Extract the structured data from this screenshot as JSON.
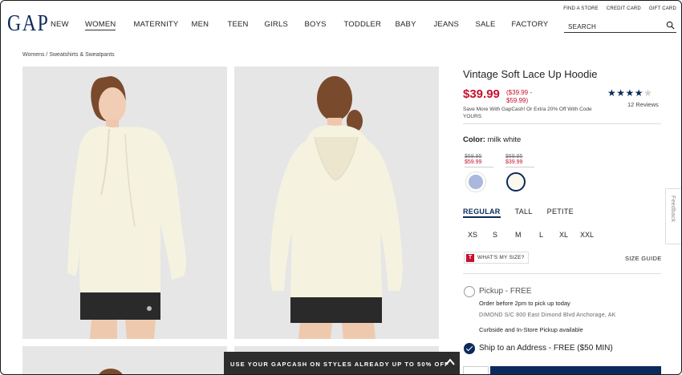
{
  "header": {
    "logo": "GAP",
    "nav": [
      "NEW",
      "WOMEN",
      "MATERNITY",
      "MEN",
      "TEEN",
      "GIRLS",
      "BOYS",
      "TODDLER",
      "BABY",
      "JEANS",
      "SALE",
      "FACTORY"
    ],
    "active_nav": "WOMEN",
    "utility_links": [
      "FIND A STORE",
      "CREDIT CARD",
      "GIFT CARD"
    ],
    "search_placeholder": "SEARCH"
  },
  "breadcrumb": "Womens / Sweatshirts & Sweatpants",
  "product": {
    "title": "Vintage Soft Lace Up Hoodie",
    "price": "$39.99",
    "price_range_line1": "($39.99 -",
    "price_range_line2": "$59.99)",
    "rating": 4,
    "rating_max": 5,
    "reviews": "12 Reviews",
    "promo": "Save More With GapCash! Or Extra 20% Off With Code YOURS",
    "color_label": "Color:",
    "color_value": "milk white",
    "swatches": [
      {
        "old_price": "$69.95",
        "new_price": "$59.99",
        "color": "#a9b8dc",
        "selected": false
      },
      {
        "old_price": "$69.95",
        "new_price": "$39.99",
        "color": "#fbf9ee",
        "selected": true
      }
    ],
    "fit_tabs": [
      "REGULAR",
      "TALL",
      "PETITE"
    ],
    "active_fit": "REGULAR",
    "sizes": [
      "XS",
      "S",
      "M",
      "L",
      "XL",
      "XXL"
    ],
    "whats_my_size": "WHAT'S MY SIZE?",
    "whats_my_size_badge": "T",
    "size_guide": "SIZE GUIDE"
  },
  "fulfillment": {
    "pickup": {
      "label": "Pickup - FREE",
      "sub": "Order before 2pm to pick up today",
      "store": "DIMOND S/C 800 East Dimond Blvd Anchorage, AK",
      "note": "Curbside and In-Store Pickup available",
      "selected": false
    },
    "ship": {
      "label": "Ship to an Address - FREE ($50 MIN)",
      "selected": true
    }
  },
  "feedback_tab": "Feedback",
  "promo_banner": "USE YOUR GAPCASH ON STYLES ALREADY UP TO 50% OFF",
  "colors": {
    "brand_navy": "#0b2a5b",
    "sale_red": "#c8102e",
    "image_bg": "#e6e6e6",
    "banner_bg": "#2d2d2d"
  }
}
